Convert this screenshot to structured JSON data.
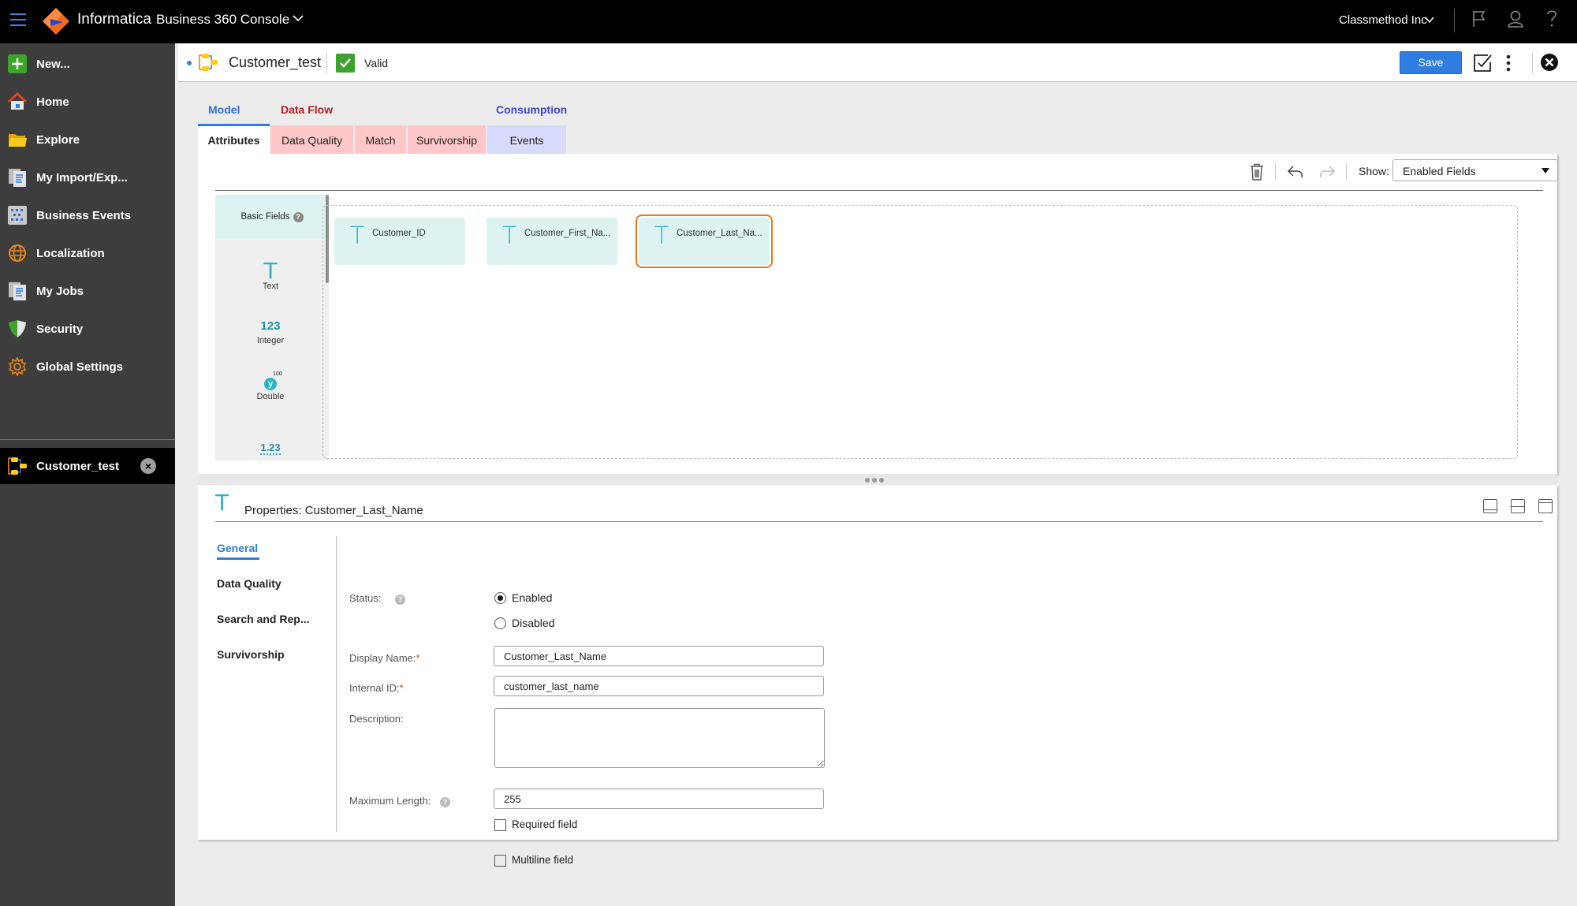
{
  "topbar": {
    "brand": "Informatica",
    "product": "Business 360 Console",
    "org": "Classmethod Inc",
    "icons": [
      "menu-icon",
      "flag-icon",
      "user-icon",
      "help-icon"
    ]
  },
  "sidebar": {
    "items": [
      {
        "label": "New...",
        "icon": "plus-icon"
      },
      {
        "label": "Home",
        "icon": "home-icon"
      },
      {
        "label": "Explore",
        "icon": "folder-icon"
      },
      {
        "label": "My Import/Exp...",
        "icon": "documents-icon"
      },
      {
        "label": "Business Events",
        "icon": "grid-icon"
      },
      {
        "label": "Localization",
        "icon": "globe-icon"
      },
      {
        "label": "My Jobs",
        "icon": "documents-icon"
      },
      {
        "label": "Security",
        "icon": "shield-icon"
      },
      {
        "label": "Global Settings",
        "icon": "gear-icon"
      }
    ],
    "open_asset": {
      "label": "Customer_test",
      "close": "×"
    }
  },
  "header": {
    "title": "Customer_test",
    "status": "Valid",
    "save_label": "Save",
    "close": "×",
    "accent": "#2f7de1",
    "valid_color": "#3ea22f"
  },
  "tabs": {
    "groups": [
      {
        "label": "Model",
        "color": "#2f6ed8"
      },
      {
        "label": "Data Flow",
        "color": "#b52020"
      },
      {
        "label": "Consumption",
        "color": "#3d47c7"
      }
    ],
    "subtabs": [
      {
        "label": "Attributes",
        "active": true
      },
      {
        "label": "Data Quality"
      },
      {
        "label": "Match"
      },
      {
        "label": "Survivorship"
      },
      {
        "label": "Events"
      }
    ]
  },
  "toolbar": {
    "show_label": "Show:",
    "show_value": "Enabled Fields"
  },
  "palette": {
    "header": "Basic Fields",
    "help": "?",
    "items": [
      {
        "glyph": "T",
        "label": "Text"
      },
      {
        "glyph": "123",
        "label": "Integer"
      },
      {
        "glyph": "y",
        "sup": "100",
        "label": "Double"
      },
      {
        "glyph": "1.23",
        "label": ""
      }
    ]
  },
  "fields": [
    {
      "glyph": "T",
      "name": "Customer_ID",
      "selected": false
    },
    {
      "glyph": "T",
      "name": "Customer_First_Na...",
      "selected": false
    },
    {
      "glyph": "T",
      "name": "Customer_Last_Na...",
      "selected": true
    }
  ],
  "properties": {
    "glyph": "T",
    "title": "Properties: Customer_Last_Name",
    "nav": [
      {
        "label": "General",
        "active": true
      },
      {
        "label": "Data Quality"
      },
      {
        "label": "Search and Rep..."
      },
      {
        "label": "Survivorship"
      }
    ],
    "status_label": "Status:",
    "status_options": [
      {
        "label": "Enabled",
        "checked": true
      },
      {
        "label": "Disabled",
        "checked": false
      }
    ],
    "display_name_label": "Display Name:",
    "display_name_value": "Customer_Last_Name",
    "internal_id_label": "Internal ID:",
    "internal_id_value": "customer_last_name",
    "description_label": "Description:",
    "description_value": "",
    "max_length_label": "Maximum Length:",
    "max_length_value": "255",
    "required_label": "Required field",
    "required_checked": false,
    "multiline_label": "Multiline field",
    "multiline_checked": false,
    "req_mark": "*",
    "help": "?"
  }
}
